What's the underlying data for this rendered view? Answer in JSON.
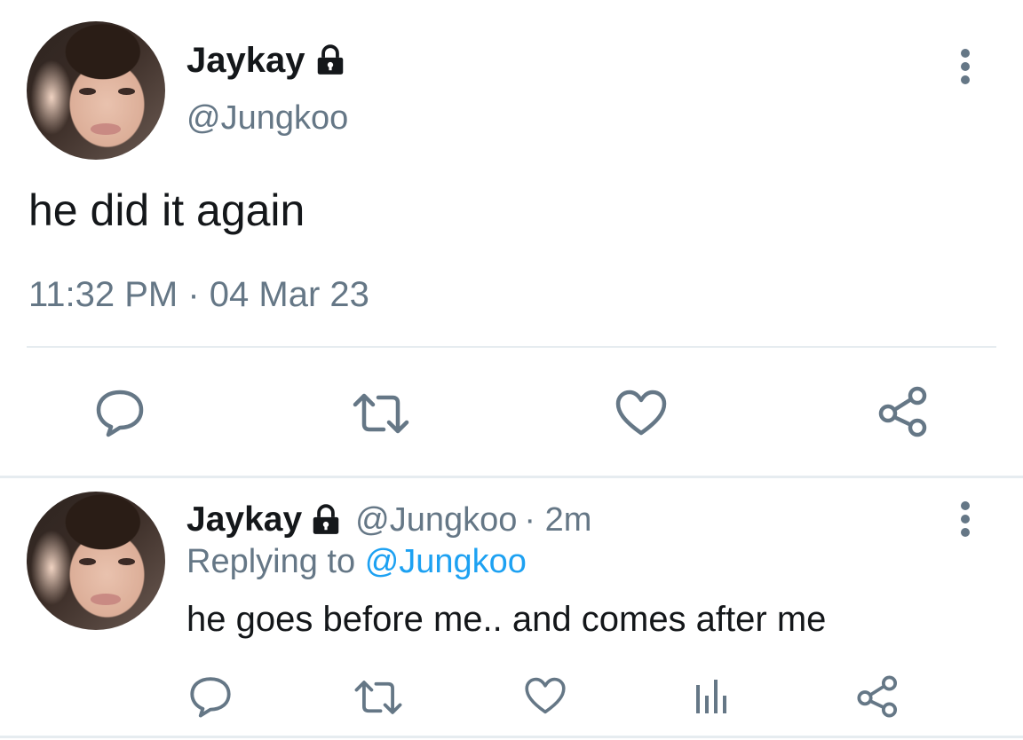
{
  "main_tweet": {
    "display_name": "Jaykay",
    "handle": "@Jungkoo",
    "text": "he did it again",
    "timestamp": "11:32 PM · 04 Mar 23"
  },
  "reply_tweet": {
    "display_name": "Jaykay",
    "handle": "@Jungkoo",
    "time_ago": "· 2m",
    "replying_prefix": "Replying to",
    "replying_handle": "@Jungkoo",
    "text": "he goes before me.. and comes after me"
  },
  "colors": {
    "text_primary": "#14171a",
    "text_secondary": "#657786",
    "link": "#1da1f2",
    "icon": "#657786",
    "divider": "#e6ecf0"
  },
  "icons": {
    "verified_lock": "lock-icon",
    "more": "more-vertical-icon",
    "reply": "reply-icon",
    "retweet": "retweet-icon",
    "like": "heart-icon",
    "share": "share-icon",
    "analytics": "analytics-icon"
  }
}
